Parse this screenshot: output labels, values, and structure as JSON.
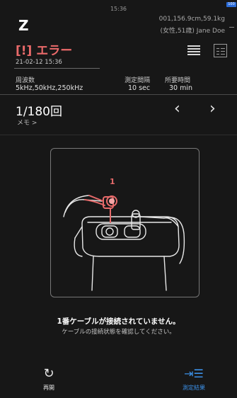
{
  "status": {
    "time": "15:36",
    "battery": "100"
  },
  "header": {
    "logo": "Z",
    "user_line1": "001,156.9cm,59.1kg",
    "user_line2": "(女性,51歳) Jane Doe"
  },
  "error": {
    "title": "[!] エラー",
    "datetime": "21-02-12 15:36"
  },
  "settings": {
    "frequency_label": "周波数",
    "frequency_value": "5kHz,50kHz,250kHz",
    "interval_label": "測定間隔",
    "interval_value": "10 sec",
    "duration_label": "所要時間",
    "duration_value": "30 min"
  },
  "measurement": {
    "count": "1/180回",
    "memo": "メモ >"
  },
  "figure": {
    "cable_number": "1",
    "highlight_color": "#e66a6a"
  },
  "message": {
    "title": "1番ケーブルが接続されていません。",
    "subtitle": "ケーブルの接続状態を確認してください。"
  },
  "nav": {
    "restart_label": "再開",
    "results_label": "測定結果",
    "accent": "#3b8fe6"
  }
}
